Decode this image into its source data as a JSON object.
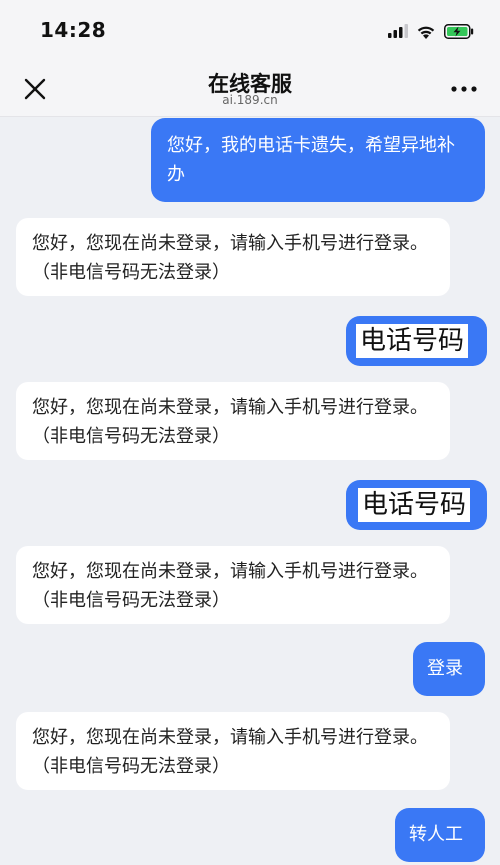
{
  "status_bar": {
    "time": "14:28",
    "icons": [
      "signal-icon",
      "wifi-icon",
      "battery-charging-icon"
    ]
  },
  "nav": {
    "title": "在线客服",
    "subtitle": "ai.189.cn",
    "close_icon": "close-icon",
    "more_icon": "more-icon"
  },
  "colors": {
    "user_bubble": "#3a78f5",
    "bot_bubble": "#ffffff",
    "background": "#eef0f4",
    "battery_green": "#34c759"
  },
  "messages": [
    {
      "sender": "user",
      "text": "您好，我的电话卡遗失，希望异地补办"
    },
    {
      "sender": "bot",
      "text": "您好，您现在尚未登录，请输入手机号进行登录。（非电信号码无法登录）"
    },
    {
      "sender": "user",
      "text": "电话号码"
    },
    {
      "sender": "bot",
      "text": "您好，您现在尚未登录，请输入手机号进行登录。（非电信号码无法登录）"
    },
    {
      "sender": "user",
      "text": "电话号码"
    },
    {
      "sender": "bot",
      "text": "您好，您现在尚未登录，请输入手机号进行登录。（非电信号码无法登录）"
    },
    {
      "sender": "user",
      "text": "登录"
    },
    {
      "sender": "bot",
      "text": "您好，您现在尚未登录，请输入手机号进行登录。（非电信号码无法登录）"
    },
    {
      "sender": "user",
      "text": "转人工"
    }
  ]
}
